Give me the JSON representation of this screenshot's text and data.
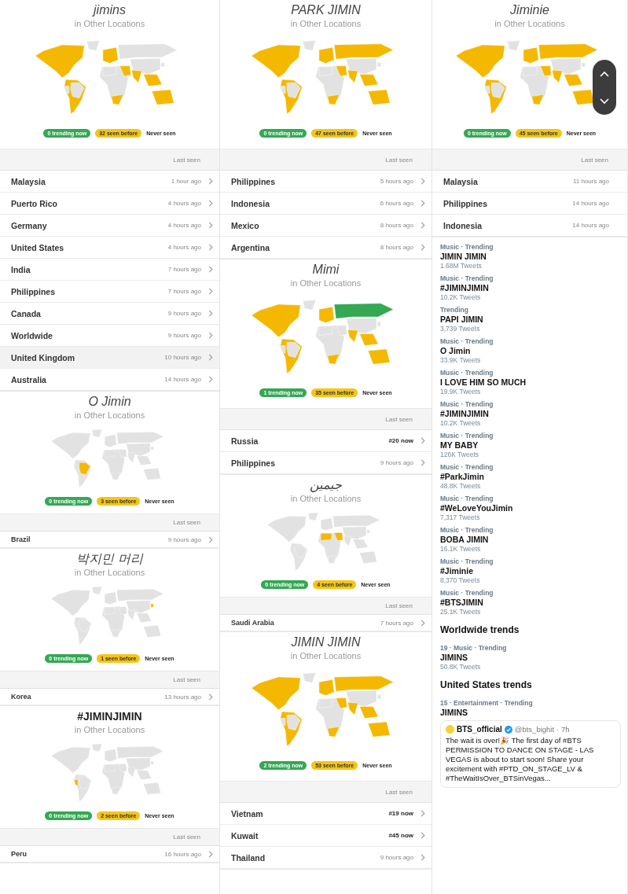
{
  "columns": [
    {
      "sections": [
        {
          "kind": "locations",
          "title": "jimins",
          "title_bold": false,
          "subtitle": "in Other Locations",
          "scroll_control": false,
          "chevrons": true,
          "map": {
            "north_america": {
              "trending": false
            },
            "south_america": {
              "trending": false
            },
            "europe": {
              "trending": false
            },
            "middle_east": {
              "trending": false
            },
            "india": {
              "trending": false
            },
            "southeast_asia": {
              "trending": false
            },
            "australia": {
              "trending": false
            },
            "south_africa": {
              "trending": false
            }
          },
          "legend": {
            "trending": "0 trending now",
            "seen": "32 seen before",
            "never": "Never seen"
          },
          "header": "Last seen",
          "rows": [
            {
              "place": "Malaysia",
              "time": "1 hour ago",
              "kind": "ago",
              "selected": false
            },
            {
              "place": "Puerto Rico",
              "time": "4 hours ago",
              "kind": "ago",
              "selected": false
            },
            {
              "place": "Germany",
              "time": "4 hours ago",
              "kind": "ago",
              "selected": false
            },
            {
              "place": "United States",
              "time": "4 hours ago",
              "kind": "ago",
              "selected": false
            },
            {
              "place": "India",
              "time": "7 hours ago",
              "kind": "ago",
              "selected": false
            },
            {
              "place": "Philippines",
              "time": "7 hours ago",
              "kind": "ago",
              "selected": false
            },
            {
              "place": "Canada",
              "time": "9 hours ago",
              "kind": "ago",
              "selected": false
            },
            {
              "place": "Worldwide",
              "time": "9 hours ago",
              "kind": "ago",
              "selected": false
            },
            {
              "place": "United Kingdom",
              "time": "10 hours ago",
              "kind": "ago",
              "selected": true
            },
            {
              "place": "Australia",
              "time": "14 hours ago",
              "kind": "ago",
              "selected": false
            }
          ]
        },
        {
          "kind": "locations",
          "title": "O Jimin",
          "title_bold": false,
          "subtitle": "in Other Locations",
          "scroll_control": false,
          "chevrons": true,
          "map": {
            "brazil": {
              "trending": false
            }
          },
          "legend": {
            "trending": "0 trending now",
            "seen": "3 seen before",
            "never": "Never seen"
          },
          "header": "Last seen",
          "rows": [
            {
              "place": "Brazil",
              "time": "9 hours ago",
              "kind": "ago"
            }
          ]
        },
        {
          "kind": "locations",
          "title": "박지민 머리",
          "title_bold": false,
          "subtitle": "in Other Locations",
          "scroll_control": false,
          "chevrons": true,
          "map": {
            "korea": {
              "trending": false
            }
          },
          "legend": {
            "trending": "0 trending now",
            "seen": "1 seen before",
            "never": "Never seen"
          },
          "header": "Last seen",
          "rows": [
            {
              "place": "Korea",
              "time": "13 hours ago",
              "kind": "ago"
            }
          ]
        },
        {
          "kind": "locations",
          "title": "#JIMINJIMIN",
          "title_bold": true,
          "subtitle": "in Other Locations",
          "scroll_control": false,
          "chevrons": true,
          "map": {
            "peru": {
              "trending": false
            }
          },
          "legend": {
            "trending": "0 trending now",
            "seen": "2 seen before",
            "never": "Never seen"
          },
          "header": "Last seen",
          "rows": [
            {
              "place": "Peru",
              "time": "16 hours ago",
              "kind": "ago"
            }
          ]
        }
      ]
    },
    {
      "sections": [
        {
          "kind": "locations",
          "title": "PARK JIMIN",
          "title_bold": false,
          "subtitle": "in Other Locations",
          "scroll_control": false,
          "chevrons": true,
          "map": {
            "north_america": {
              "trending": false
            },
            "south_america": {
              "trending": false
            },
            "europe": {
              "trending": false
            },
            "russia": {
              "trending": false
            },
            "middle_east": {
              "trending": false
            },
            "india": {
              "trending": false
            },
            "southeast_asia": {
              "trending": false
            },
            "australia": {
              "trending": false
            },
            "south_africa": {
              "trending": false
            }
          },
          "legend": {
            "trending": "0 trending now",
            "seen": "47 seen before",
            "never": "Never seen"
          },
          "header": "Last seen",
          "rows": [
            {
              "place": "Philippines",
              "time": "5 hours ago",
              "kind": "ago"
            },
            {
              "place": "Indonesia",
              "time": "6 hours ago",
              "kind": "ago"
            },
            {
              "place": "Mexico",
              "time": "8 hours ago",
              "kind": "ago"
            },
            {
              "place": "Argentina",
              "time": "8 hours ago",
              "kind": "ago"
            }
          ]
        },
        {
          "kind": "locations",
          "title": "Mimi",
          "title_bold": false,
          "subtitle": "in Other Locations",
          "scroll_control": false,
          "chevrons": true,
          "map": {
            "north_america": {
              "trending": false
            },
            "south_america": {
              "trending": false
            },
            "europe": {
              "trending": false
            },
            "russia": {
              "trending": true
            },
            "india": {
              "trending": false
            },
            "southeast_asia": {
              "trending": false
            },
            "australia": {
              "trending": false
            },
            "south_africa": {
              "trending": false
            }
          },
          "legend": {
            "trending": "1 trending now",
            "seen": "35 seen before",
            "never": "Never seen"
          },
          "header": "Last seen",
          "rows": [
            {
              "place": "Russia",
              "time": "#20 now",
              "kind": "now"
            },
            {
              "place": "Philippines",
              "time": "9 hours ago",
              "kind": "ago"
            }
          ]
        },
        {
          "kind": "locations",
          "title": "جيمين",
          "title_bold": false,
          "subtitle": "in Other Locations",
          "scroll_control": false,
          "chevrons": true,
          "map": {
            "north_africa": {
              "trending": false
            },
            "middle_east": {
              "trending": false
            }
          },
          "legend": {
            "trending": "0 trending now",
            "seen": "4 seen before",
            "never": "Never seen"
          },
          "header": "Last seen",
          "rows": [
            {
              "place": "Saudi Arabia",
              "time": "7 hours ago",
              "kind": "ago"
            }
          ]
        },
        {
          "kind": "locations",
          "title": "JIMIN JIMIN",
          "title_bold": false,
          "subtitle": "in Other Locations",
          "scroll_control": false,
          "chevrons": true,
          "map": {
            "north_america": {
              "trending": false
            },
            "south_america": {
              "trending": false
            },
            "europe": {
              "trending": false
            },
            "russia": {
              "trending": false
            },
            "middle_east": {
              "trending": false
            },
            "india": {
              "trending": false
            },
            "southeast_asia": {
              "trending": false
            },
            "australia": {
              "trending": false
            },
            "south_africa": {
              "trending": false
            }
          },
          "legend": {
            "trending": "2 trending now",
            "seen": "53 seen before",
            "never": "Never seen"
          },
          "header": "Last seen",
          "rows": [
            {
              "place": "Vietnam",
              "time": "#19 now",
              "kind": "now"
            },
            {
              "place": "Kuwait",
              "time": "#45 now",
              "kind": "now"
            },
            {
              "place": "Thailand",
              "time": "9 hours ago",
              "kind": "ago"
            }
          ]
        }
      ]
    },
    {
      "sections": [
        {
          "kind": "locations",
          "title": "Jiminie",
          "title_bold": false,
          "subtitle": "in Other Locations",
          "scroll_control": true,
          "chevrons": false,
          "map": {
            "north_america": {
              "trending": false
            },
            "south_america": {
              "trending": false
            },
            "europe": {
              "trending": false
            },
            "russia": {
              "trending": false
            },
            "middle_east": {
              "trending": false
            },
            "india": {
              "trending": false
            },
            "southeast_asia": {
              "trending": false
            },
            "australia": {
              "trending": false
            },
            "south_africa": {
              "trending": false
            }
          },
          "legend": {
            "trending": "0 trending now",
            "seen": "45 seen before",
            "never": "Never seen"
          },
          "header": "Last seen",
          "rows": [
            {
              "place": "Malaysia",
              "time": "11 hours ago",
              "kind": "ago"
            },
            {
              "place": "Philippines",
              "time": "14 hours ago",
              "kind": "ago"
            },
            {
              "place": "Indonesia",
              "time": "14 hours ago",
              "kind": "ago"
            }
          ]
        },
        {
          "kind": "trends",
          "items": [
            {
              "kind": "trend",
              "category": "Music · Trending",
              "name": "JIMIN JIMIN",
              "count": "1.68M Tweets"
            },
            {
              "kind": "trend",
              "category": "Music · Trending",
              "name": "#JIMINJIMIN",
              "count": "10.2K Tweets"
            },
            {
              "kind": "trend",
              "category": "Trending",
              "name": "PAPI JIMIN",
              "count": "3,739 Tweets"
            },
            {
              "kind": "trend",
              "category": "Music · Trending",
              "name": "O Jimin",
              "count": "33.9K Tweets"
            },
            {
              "kind": "trend",
              "category": "Music · Trending",
              "name": "I LOVE HIM SO MUCH",
              "count": "19.9K Tweets"
            },
            {
              "kind": "trend",
              "category": "Music · Trending",
              "name": "#JIMINJIMIN",
              "count": "10.2K Tweets"
            },
            {
              "kind": "trend",
              "category": "Music · Trending",
              "name": "MY BABY",
              "count": "126K Tweets"
            },
            {
              "kind": "trend",
              "category": "Music · Trending",
              "name": "#ParkJimin",
              "count": "48.8K Tweets"
            },
            {
              "kind": "trend",
              "category": "Music · Trending",
              "name": "#WeLoveYouJimin",
              "count": "7,317 Tweets"
            },
            {
              "kind": "trend",
              "category": "Music · Trending",
              "name": "BOBA JIMIN",
              "count": "16.1K Tweets"
            },
            {
              "kind": "trend",
              "category": "Music · Trending",
              "name": "#Jiminie",
              "count": "8,370 Tweets"
            },
            {
              "kind": "trend",
              "category": "Music · Trending",
              "name": "#BTSJIMIN",
              "count": "25.1K Tweets"
            },
            {
              "kind": "heading",
              "text": "Worldwide trends"
            },
            {
              "kind": "trend",
              "category": "19 · Music · Trending",
              "name": "JIMINS",
              "count": "50.8K Tweets"
            },
            {
              "kind": "heading",
              "text": "United States trends"
            },
            {
              "kind": "trend",
              "category": "15 · Entertainment · Trending",
              "name": "JIMINS"
            },
            {
              "kind": "tweet",
              "author": "BTS_official",
              "handle": "@bts_bighit",
              "time": "· 7h",
              "text": "The wait is over!🎉 The first day of #BTS PERMISSION TO DANCE ON STAGE - LAS VEGAS is about to start soon! Share your excitement with #PTD_ON_STAGE_LV & #TheWaitIsOver_BTSinVegas..."
            }
          ]
        }
      ]
    }
  ]
}
